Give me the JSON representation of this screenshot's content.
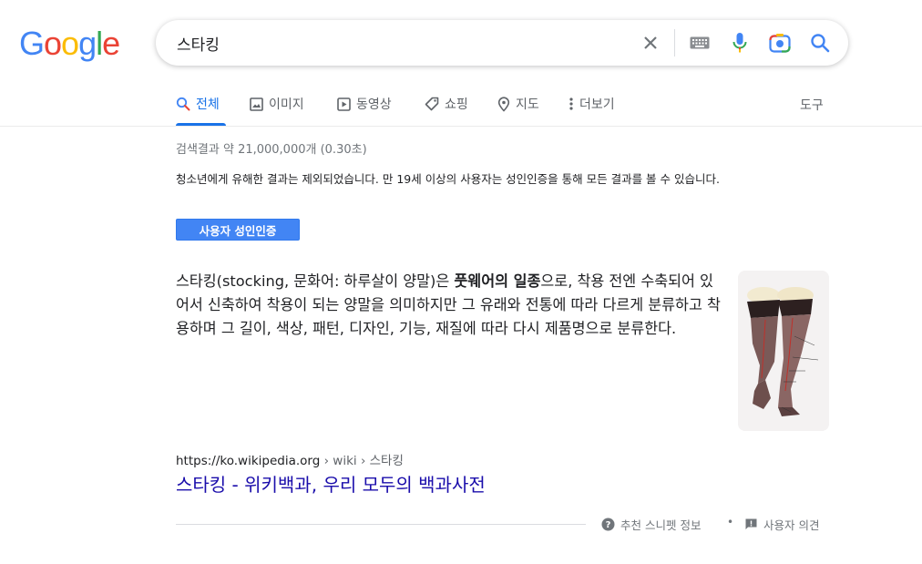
{
  "logo": {
    "letters": [
      "G",
      "o",
      "o",
      "g",
      "l",
      "e"
    ],
    "colors": [
      "#4285F4",
      "#EA4335",
      "#FBBC05",
      "#4285F4",
      "#34A853",
      "#EA4335"
    ]
  },
  "search": {
    "query": "스타킹"
  },
  "tabs": [
    {
      "label": "전체",
      "icon": "search-icon",
      "active": true
    },
    {
      "label": "이미지",
      "icon": "image-icon"
    },
    {
      "label": "동영상",
      "icon": "video-icon"
    },
    {
      "label": "쇼핑",
      "icon": "tag-icon"
    },
    {
      "label": "지도",
      "icon": "map-pin-icon"
    },
    {
      "label": "더보기",
      "icon": "more-vert-icon"
    }
  ],
  "tools_label": "도구",
  "stats": "검색결과 약 21,000,000개 (0.30초)",
  "safe_note": "청소년에게 유해한 결과는 제외되었습니다. 만 19세 이상의 사용자는 성인인증을 통해 모든 결과를 볼 수 있습니다.",
  "adult_button": "사용자 성인인증",
  "snippet": {
    "before": "스타킹(stocking, 문화어: 하루살이 양말)은 ",
    "bold": "풋웨어의 일종",
    "after": "으로, 착용 전엔 수축되어 있어서 신축하여 착용이 되는 양말을 의미하지만 그 유래와 전통에 따라 다르게 분류하고 착용하며 그 길이, 색상, 패턴, 디자인, 기능, 재질에 따라 다시 제품명으로 분류한다."
  },
  "result": {
    "domain": "https://ko.wikipedia.org",
    "path": " › wiki › 스타킹",
    "title": "스타킹 - 위키백과, 우리 모두의 백과사전"
  },
  "footer": {
    "about": "추천 스니펫 정보",
    "separator": "•",
    "feedback": "사용자 의견"
  },
  "colors": {
    "accent": "#1a73e8",
    "link": "#1a0dab",
    "button": "#4285f4"
  }
}
